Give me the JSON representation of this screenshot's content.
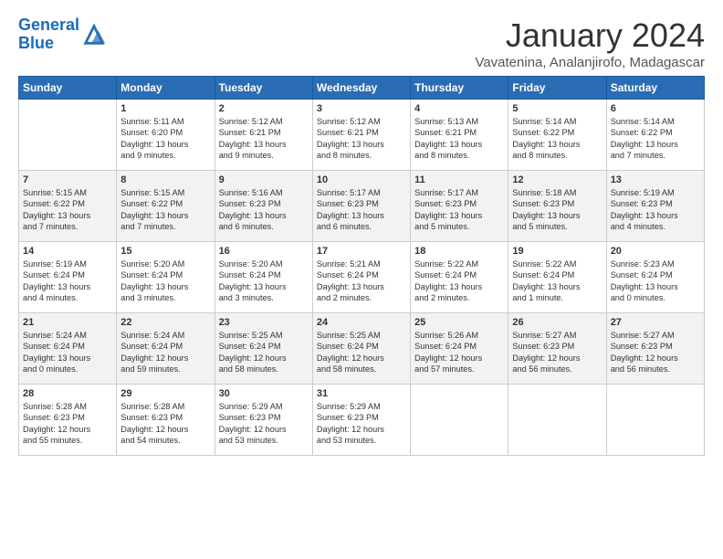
{
  "logo": {
    "line1": "General",
    "line2": "Blue"
  },
  "title": "January 2024",
  "location": "Vavatenina, Analanjirofo, Madagascar",
  "header": {
    "days": [
      "Sunday",
      "Monday",
      "Tuesday",
      "Wednesday",
      "Thursday",
      "Friday",
      "Saturday"
    ]
  },
  "weeks": [
    [
      {
        "day": "",
        "content": ""
      },
      {
        "day": "1",
        "content": "Sunrise: 5:11 AM\nSunset: 6:20 PM\nDaylight: 13 hours\nand 9 minutes."
      },
      {
        "day": "2",
        "content": "Sunrise: 5:12 AM\nSunset: 6:21 PM\nDaylight: 13 hours\nand 9 minutes."
      },
      {
        "day": "3",
        "content": "Sunrise: 5:12 AM\nSunset: 6:21 PM\nDaylight: 13 hours\nand 8 minutes."
      },
      {
        "day": "4",
        "content": "Sunrise: 5:13 AM\nSunset: 6:21 PM\nDaylight: 13 hours\nand 8 minutes."
      },
      {
        "day": "5",
        "content": "Sunrise: 5:14 AM\nSunset: 6:22 PM\nDaylight: 13 hours\nand 8 minutes."
      },
      {
        "day": "6",
        "content": "Sunrise: 5:14 AM\nSunset: 6:22 PM\nDaylight: 13 hours\nand 7 minutes."
      }
    ],
    [
      {
        "day": "7",
        "content": "Sunrise: 5:15 AM\nSunset: 6:22 PM\nDaylight: 13 hours\nand 7 minutes."
      },
      {
        "day": "8",
        "content": "Sunrise: 5:15 AM\nSunset: 6:22 PM\nDaylight: 13 hours\nand 7 minutes."
      },
      {
        "day": "9",
        "content": "Sunrise: 5:16 AM\nSunset: 6:23 PM\nDaylight: 13 hours\nand 6 minutes."
      },
      {
        "day": "10",
        "content": "Sunrise: 5:17 AM\nSunset: 6:23 PM\nDaylight: 13 hours\nand 6 minutes."
      },
      {
        "day": "11",
        "content": "Sunrise: 5:17 AM\nSunset: 6:23 PM\nDaylight: 13 hours\nand 5 minutes."
      },
      {
        "day": "12",
        "content": "Sunrise: 5:18 AM\nSunset: 6:23 PM\nDaylight: 13 hours\nand 5 minutes."
      },
      {
        "day": "13",
        "content": "Sunrise: 5:19 AM\nSunset: 6:23 PM\nDaylight: 13 hours\nand 4 minutes."
      }
    ],
    [
      {
        "day": "14",
        "content": "Sunrise: 5:19 AM\nSunset: 6:24 PM\nDaylight: 13 hours\nand 4 minutes."
      },
      {
        "day": "15",
        "content": "Sunrise: 5:20 AM\nSunset: 6:24 PM\nDaylight: 13 hours\nand 3 minutes."
      },
      {
        "day": "16",
        "content": "Sunrise: 5:20 AM\nSunset: 6:24 PM\nDaylight: 13 hours\nand 3 minutes."
      },
      {
        "day": "17",
        "content": "Sunrise: 5:21 AM\nSunset: 6:24 PM\nDaylight: 13 hours\nand 2 minutes."
      },
      {
        "day": "18",
        "content": "Sunrise: 5:22 AM\nSunset: 6:24 PM\nDaylight: 13 hours\nand 2 minutes."
      },
      {
        "day": "19",
        "content": "Sunrise: 5:22 AM\nSunset: 6:24 PM\nDaylight: 13 hours\nand 1 minute."
      },
      {
        "day": "20",
        "content": "Sunrise: 5:23 AM\nSunset: 6:24 PM\nDaylight: 13 hours\nand 0 minutes."
      }
    ],
    [
      {
        "day": "21",
        "content": "Sunrise: 5:24 AM\nSunset: 6:24 PM\nDaylight: 13 hours\nand 0 minutes."
      },
      {
        "day": "22",
        "content": "Sunrise: 5:24 AM\nSunset: 6:24 PM\nDaylight: 12 hours\nand 59 minutes."
      },
      {
        "day": "23",
        "content": "Sunrise: 5:25 AM\nSunset: 6:24 PM\nDaylight: 12 hours\nand 58 minutes."
      },
      {
        "day": "24",
        "content": "Sunrise: 5:25 AM\nSunset: 6:24 PM\nDaylight: 12 hours\nand 58 minutes."
      },
      {
        "day": "25",
        "content": "Sunrise: 5:26 AM\nSunset: 6:24 PM\nDaylight: 12 hours\nand 57 minutes."
      },
      {
        "day": "26",
        "content": "Sunrise: 5:27 AM\nSunset: 6:23 PM\nDaylight: 12 hours\nand 56 minutes."
      },
      {
        "day": "27",
        "content": "Sunrise: 5:27 AM\nSunset: 6:23 PM\nDaylight: 12 hours\nand 56 minutes."
      }
    ],
    [
      {
        "day": "28",
        "content": "Sunrise: 5:28 AM\nSunset: 6:23 PM\nDaylight: 12 hours\nand 55 minutes."
      },
      {
        "day": "29",
        "content": "Sunrise: 5:28 AM\nSunset: 6:23 PM\nDaylight: 12 hours\nand 54 minutes."
      },
      {
        "day": "30",
        "content": "Sunrise: 5:29 AM\nSunset: 6:23 PM\nDaylight: 12 hours\nand 53 minutes."
      },
      {
        "day": "31",
        "content": "Sunrise: 5:29 AM\nSunset: 6:23 PM\nDaylight: 12 hours\nand 53 minutes."
      },
      {
        "day": "",
        "content": ""
      },
      {
        "day": "",
        "content": ""
      },
      {
        "day": "",
        "content": ""
      }
    ]
  ]
}
